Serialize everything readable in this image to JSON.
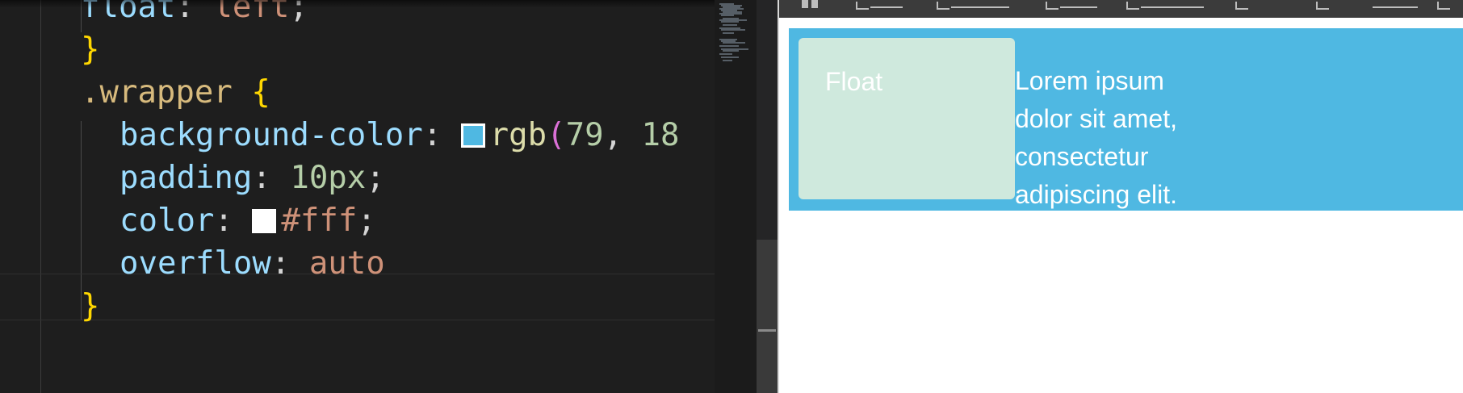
{
  "editor": {
    "lines": [
      {
        "tokens": [
          {
            "t": "float",
            "c": "prop"
          },
          {
            "t": ": ",
            "c": "punc"
          },
          {
            "t": "left",
            "c": "str"
          },
          {
            "t": ";",
            "c": "punc"
          }
        ]
      },
      {
        "tokens": [
          {
            "t": "}",
            "c": "brace"
          }
        ]
      },
      {
        "tokens": [
          {
            "t": ".wrapper",
            "c": "sel"
          },
          {
            "t": " ",
            "c": "punc"
          },
          {
            "t": "{",
            "c": "brace"
          }
        ]
      },
      {
        "tokens": [
          {
            "t": "background-color",
            "c": "prop"
          },
          {
            "t": ": ",
            "c": "punc"
          },
          {
            "swatch": "#4fb8e2"
          },
          {
            "t": "rgb",
            "c": "fn"
          },
          {
            "t": "(",
            "c": "paren"
          },
          {
            "t": "79",
            "c": "num"
          },
          {
            "t": ", ",
            "c": "punc"
          },
          {
            "t": "18",
            "c": "num"
          }
        ]
      },
      {
        "tokens": [
          {
            "t": "padding",
            "c": "prop"
          },
          {
            "t": ": ",
            "c": "punc"
          },
          {
            "t": "10px",
            "c": "num"
          },
          {
            "t": ";",
            "c": "punc"
          }
        ]
      },
      {
        "tokens": [
          {
            "t": "color",
            "c": "prop"
          },
          {
            "t": ": ",
            "c": "punc"
          },
          {
            "swatch": "#ffffff"
          },
          {
            "t": "#fff",
            "c": "str"
          },
          {
            "t": ";",
            "c": "punc"
          }
        ]
      },
      {
        "tokens": [
          {
            "t": "overflow",
            "c": "prop"
          },
          {
            "t": ": ",
            "c": "punc"
          },
          {
            "t": "auto",
            "c": "str"
          }
        ]
      },
      {
        "tokens": [
          {
            "t": "}",
            "c": "brace"
          }
        ]
      }
    ]
  },
  "preview": {
    "float_label": "Float",
    "body_text": "Lorem ipsum dolor sit amet, consectetur adipiscing elit.",
    "wrapper_color": "#4fb8e2",
    "float_color": "#cfe9dd",
    "text_color": "#ffffff"
  }
}
